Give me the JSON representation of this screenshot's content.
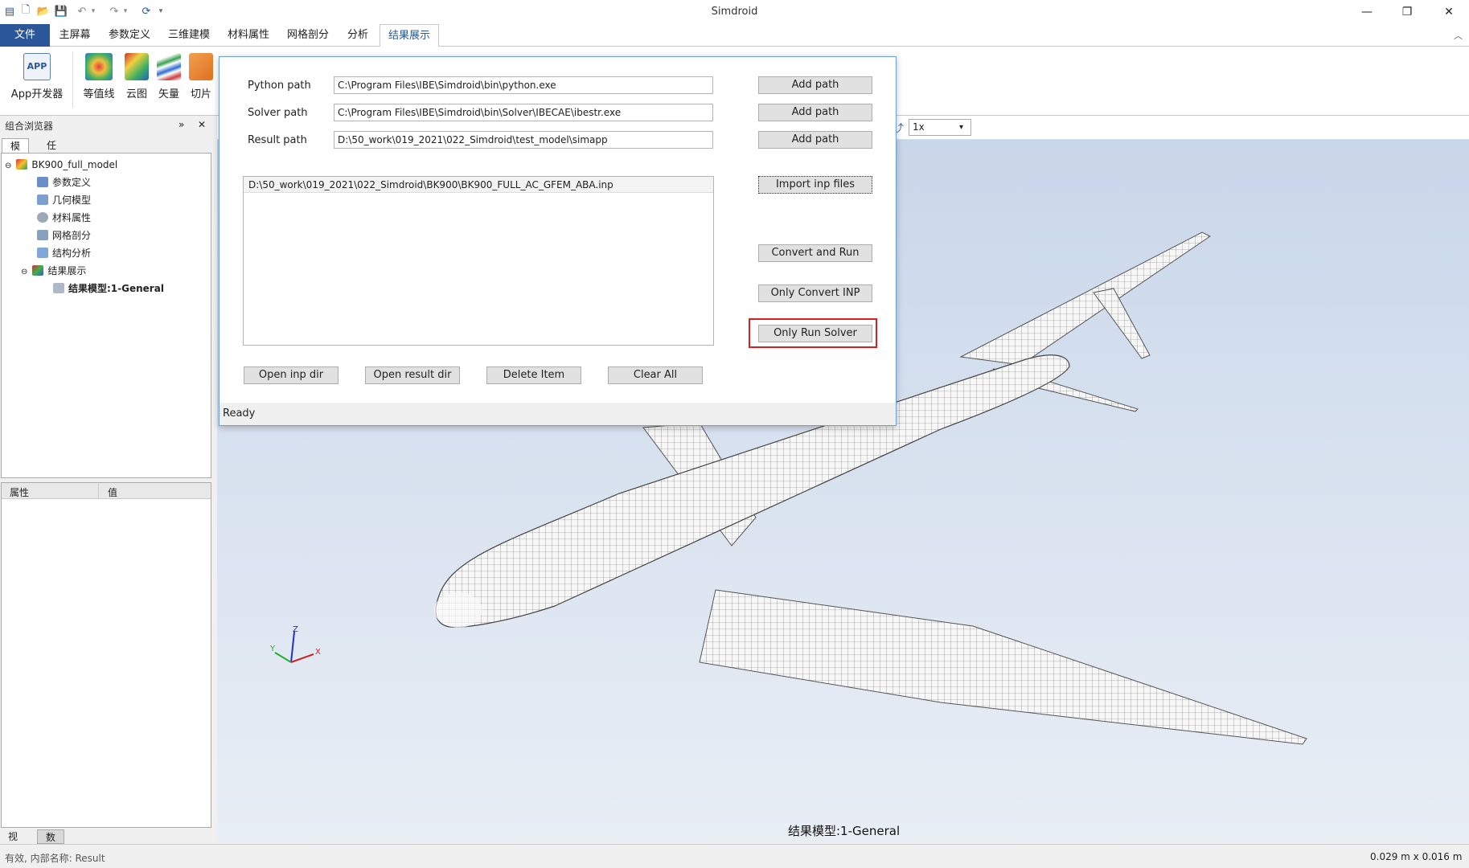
{
  "app_title": "Simdroid",
  "window_controls": [
    "—",
    "❐",
    "✕"
  ],
  "menu": {
    "file": "文件",
    "tabs": [
      "主屏幕",
      "参数定义",
      "三维建模",
      "材料属性",
      "网格剖分",
      "分析"
    ],
    "active_tab": "结果展示"
  },
  "ribbon": {
    "app_icon_text": "APP",
    "buttons": [
      "App开发器",
      "等值线",
      "云图",
      "矢量",
      "切片"
    ]
  },
  "left_panel": {
    "title": "组合浏览器",
    "tabs": [
      "模型",
      "任务"
    ],
    "tree": {
      "root": "BK900_full_model",
      "items": [
        "参数定义",
        "几何模型",
        "材料属性",
        "网格剖分",
        "结构分析",
        "结果展示"
      ],
      "sub_item": "结果模型:1-General"
    },
    "props_headers": [
      "属性",
      "值"
    ],
    "bottom_tabs": [
      "视图",
      "数据"
    ]
  },
  "viewport": {
    "speed_select": "1x",
    "model_label": "结果模型:1-General",
    "axes": {
      "x": "X",
      "y": "Y",
      "z": "Z"
    }
  },
  "dialog": {
    "python_label": "Python path",
    "python_value": "C:\\Program Files\\IBE\\Simdroid\\bin\\python.exe",
    "solver_label": "Solver path",
    "solver_value": "C:\\Program Files\\IBE\\Simdroid\\bin\\Solver\\IBECAE\\ibestr.exe",
    "result_label": "Result path",
    "result_value": "D:\\50_work\\019_2021\\022_Simdroid\\test_model\\simapp",
    "add_path": "Add path",
    "file_list": [
      "D:\\50_work\\019_2021\\022_Simdroid\\BK900\\BK900_FULL_AC_GFEM_ABA.inp"
    ],
    "import_btn": "Import inp files",
    "convert_run_btn": "Convert and Run",
    "only_convert_btn": "Only Convert INP",
    "only_run_btn": "Only Run Solver",
    "open_inp_btn": "Open inp dir",
    "open_result_btn": "Open result dir",
    "delete_btn": "Delete Item",
    "clear_btn": "Clear All",
    "status": "Ready"
  },
  "statusbar": {
    "left": "有效, 内部名称: Result",
    "right": "0.029 m x 0.016 m"
  },
  "colors": {
    "accent": "#2b579a",
    "highlight": "#d82020"
  }
}
